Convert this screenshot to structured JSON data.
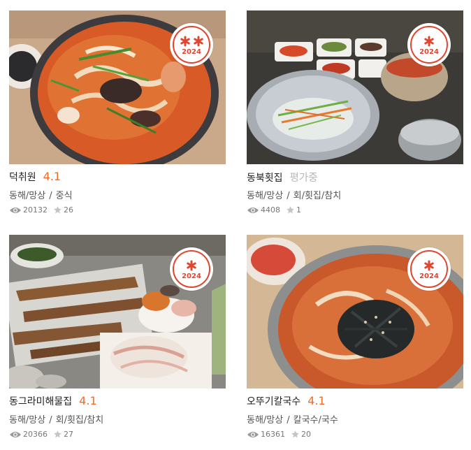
{
  "restaurants": [
    {
      "name": "덕취원",
      "score": "4.1",
      "region": "동해/망상",
      "category": "중식",
      "views": "20132",
      "favorites": "26",
      "award_year": "2024",
      "award_stars": 2
    },
    {
      "name": "동북횟집",
      "score": "평가중",
      "region": "동해/망상",
      "category": "회/횟집/참치",
      "views": "4408",
      "favorites": "1",
      "award_year": "2024",
      "award_stars": 1
    },
    {
      "name": "동그라미해물집",
      "score": "4.1",
      "region": "동해/망상",
      "category": "회/횟집/참치",
      "views": "20366",
      "favorites": "27",
      "award_year": "2024",
      "award_stars": 1
    },
    {
      "name": "오뚜기칼국수",
      "score": "4.1",
      "region": "동해/망상",
      "category": "칼국수/국수",
      "views": "16361",
      "favorites": "20",
      "award_year": "2024",
      "award_stars": 1
    }
  ],
  "separator": "/",
  "icons": {
    "views": "eye-icon",
    "favorites": "star-icon",
    "award": "flower-star-icon"
  },
  "colors": {
    "score": "#f36b25",
    "score_pending": "#b7b7b7",
    "award": "#e0452f"
  }
}
